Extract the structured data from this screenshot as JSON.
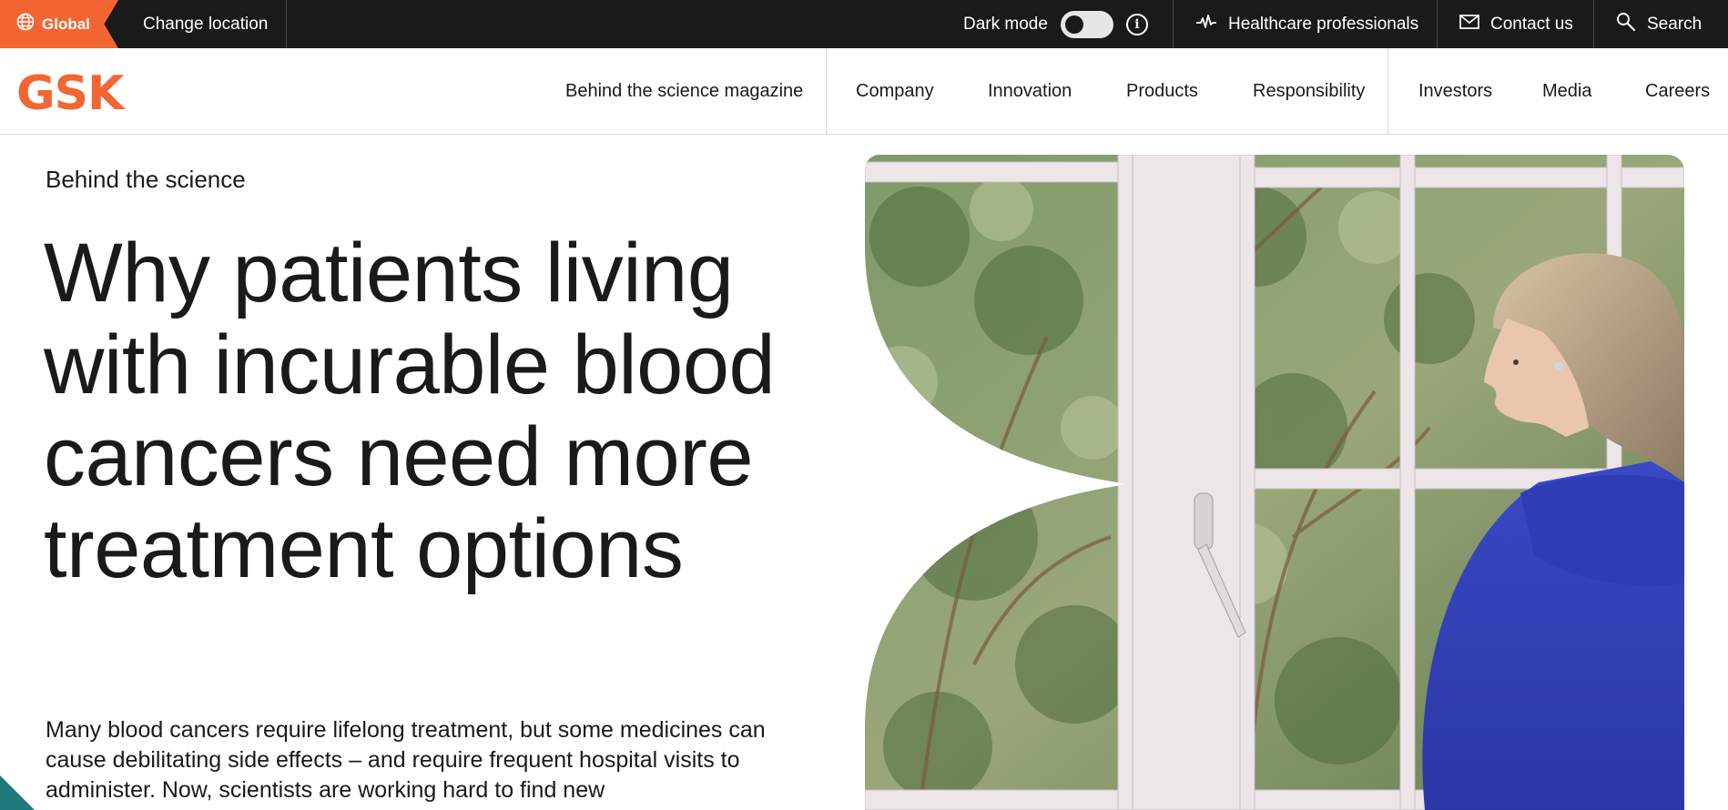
{
  "topbar": {
    "global_label": "Global",
    "change_location": "Change location",
    "dark_mode_label": "Dark mode",
    "dark_mode_on": false,
    "healthcare_label": "Healthcare professionals",
    "contact_label": "Contact us",
    "search_label": "Search"
  },
  "brand": {
    "logo_text": "GSK",
    "accent_color": "#f36633"
  },
  "nav": {
    "magazine": "Behind the science magazine",
    "items": [
      "Company",
      "Innovation",
      "Products",
      "Responsibility"
    ],
    "secondary": [
      "Investors",
      "Media",
      "Careers"
    ]
  },
  "hero": {
    "eyebrow": "Behind the science",
    "headline": "Why patients living with incurable blood cancers need more treatment options",
    "intro": "Many blood cancers require lifelong treatment, but some medicines can cause debilitating side effects – and require frequent hospital visits to administer. Now, scientists are working hard to find new"
  }
}
